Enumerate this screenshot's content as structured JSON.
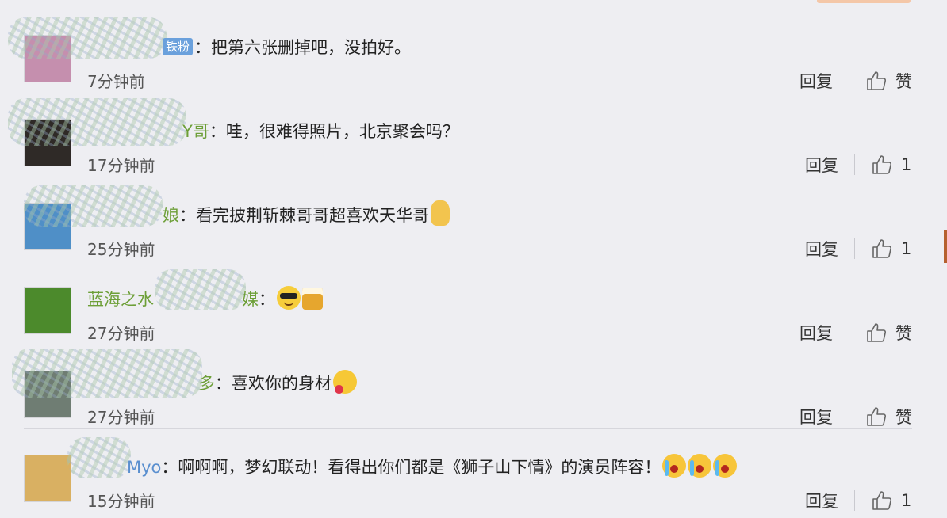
{
  "comments": [
    {
      "name_tail": "铁粉",
      "text": "：把第六张删掉吧，没拍好。",
      "time": "7分钟前",
      "reply": "回复",
      "like": "赞",
      "avatar_color": "#c58fae"
    },
    {
      "name_tail": "Y哥",
      "text": "：哇，很难得照片，北京聚会吗？",
      "time": "17分钟前",
      "reply": "回复",
      "like": "1",
      "avatar_color": "#2f2a27"
    },
    {
      "name_tail": "娘",
      "text": "：看完披荆斩棘哥哥超喜欢天华哥",
      "time": "25分钟前",
      "reply": "回复",
      "like": "1",
      "avatar_color": "#4f8fc7"
    },
    {
      "name_tail_a": "蓝海之水",
      "name_tail_b": "媒",
      "text": "：",
      "time": "27分钟前",
      "reply": "回复",
      "like": "赞",
      "avatar_color": "#4c8a2c"
    },
    {
      "name_tail": "多",
      "text": "：喜欢你的身材",
      "time": "27分钟前",
      "reply": "回复",
      "like": "赞",
      "avatar_color": "#6f7d73"
    },
    {
      "name_tail": "Myo",
      "text": "：啊啊啊，梦幻联动！看得出你们都是《狮子山下情》的演员阵容！",
      "time": "15分钟前",
      "reply": "回复",
      "like": "1",
      "avatar_color": "#d9b062"
    }
  ]
}
